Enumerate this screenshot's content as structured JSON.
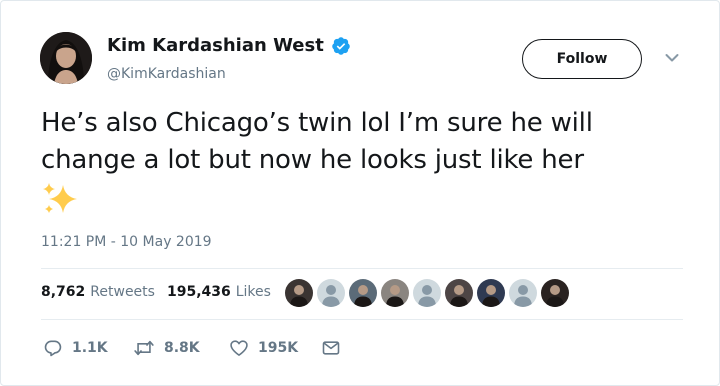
{
  "author": {
    "display_name": "Kim Kardashian West",
    "handle": "@KimKardashian",
    "verified": true
  },
  "header": {
    "follow_label": "Follow"
  },
  "tweet": {
    "text": "He’s also Chicago’s twin lol I’m sure he will change a lot but now he looks just like her",
    "emoji": "sparkles",
    "timestamp": "11:21 PM - 10 May 2019"
  },
  "stats": {
    "retweets_count": "8,762",
    "retweets_label": "Retweets",
    "likes_count": "195,436",
    "likes_label": "Likes"
  },
  "liker_avatars": [
    {
      "kind": "photo",
      "color": "#3a3432"
    },
    {
      "kind": "default",
      "color": "#cfd9de"
    },
    {
      "kind": "photo",
      "color": "#5b6b78"
    },
    {
      "kind": "photo",
      "color": "#8a8580"
    },
    {
      "kind": "default",
      "color": "#cfd9de"
    },
    {
      "kind": "photo",
      "color": "#4d4545"
    },
    {
      "kind": "photo",
      "color": "#2f3a52"
    },
    {
      "kind": "default",
      "color": "#cfd9de"
    },
    {
      "kind": "photo",
      "color": "#2a2321"
    }
  ],
  "actions": {
    "reply_count": "1.1K",
    "retweet_count": "8.8K",
    "like_count": "195K"
  },
  "colors": {
    "text": "#14171a",
    "secondary": "#657786",
    "verified_blue": "#1da1f2",
    "border": "#e6ecf0"
  }
}
